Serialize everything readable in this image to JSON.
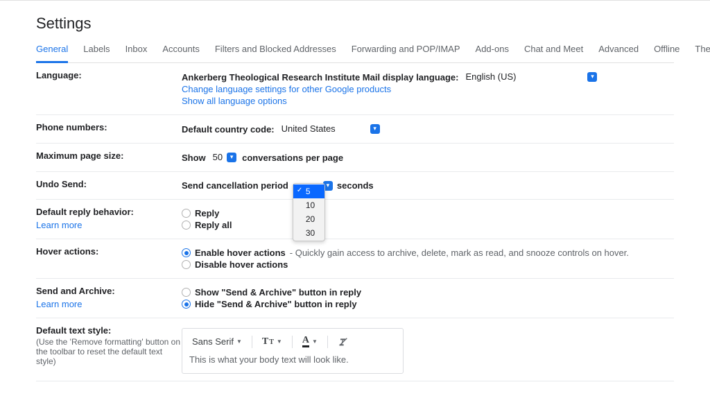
{
  "title": "Settings",
  "tabs": [
    {
      "label": "General",
      "active": true
    },
    {
      "label": "Labels"
    },
    {
      "label": "Inbox"
    },
    {
      "label": "Accounts"
    },
    {
      "label": "Filters and Blocked Addresses"
    },
    {
      "label": "Forwarding and POP/IMAP"
    },
    {
      "label": "Add-ons"
    },
    {
      "label": "Chat and Meet"
    },
    {
      "label": "Advanced"
    },
    {
      "label": "Offline"
    },
    {
      "label": "Themes"
    }
  ],
  "language": {
    "label": "Language:",
    "display_label": "Ankerberg Theological Research Institute Mail display language:",
    "selected": "English (US)",
    "change_link": "Change language settings for other Google products",
    "show_all_link": "Show all language options"
  },
  "phone": {
    "label": "Phone numbers:",
    "code_label": "Default country code:",
    "selected": "United States"
  },
  "page_size": {
    "label": "Maximum page size:",
    "show": "Show",
    "value": "50",
    "suffix": "conversations per page"
  },
  "undo": {
    "label": "Undo Send:",
    "period_label": "Send cancellation period",
    "seconds_label": "seconds",
    "selected": "5",
    "options": [
      "5",
      "10",
      "20",
      "30"
    ]
  },
  "reply": {
    "label": "Default reply behavior:",
    "learn_more": "Learn more",
    "options": [
      {
        "label": "Reply",
        "checked": false
      },
      {
        "label": "Reply all",
        "checked": false
      }
    ]
  },
  "hover": {
    "label": "Hover actions:",
    "options": [
      {
        "label": "Enable hover actions",
        "desc": "Quickly gain access to archive, delete, mark as read, and snooze controls on hover.",
        "checked": true
      },
      {
        "label": "Disable hover actions",
        "checked": false
      }
    ]
  },
  "send_archive": {
    "label": "Send and Archive:",
    "learn_more": "Learn more",
    "options": [
      {
        "label": "Show \"Send & Archive\" button in reply",
        "checked": false
      },
      {
        "label": "Hide \"Send & Archive\" button in reply",
        "checked": true
      }
    ]
  },
  "text_style": {
    "label": "Default text style:",
    "hint": "(Use the 'Remove formatting' button on the toolbar to reset the default text style)",
    "font": "Sans Serif",
    "preview": "This is what your body text will look like."
  }
}
